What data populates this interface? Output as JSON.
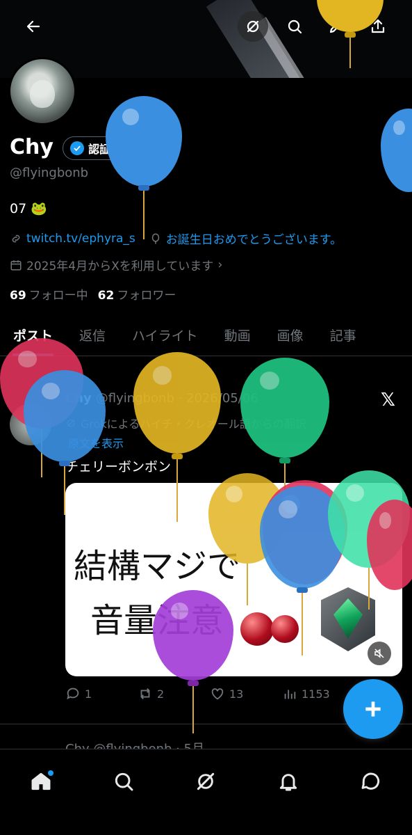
{
  "profile": {
    "name": "Chy",
    "verify_label": "認証を受ける",
    "handle": "@flyingbonb",
    "bio": "07 🐸",
    "link": "twitch.tv/ephyra_s",
    "birthday": "お誕生日おめでとうございます。",
    "joined": "2025年4月からXを利用しています",
    "following_count": "69",
    "following_label": "フォロー中",
    "followers_count": "62",
    "followers_label": "フォロワー"
  },
  "tabs": [
    "ポスト",
    "返信",
    "ハイライト",
    "動画",
    "画像",
    "記事"
  ],
  "post": {
    "name": "Chy",
    "handle_date": "@flyingbonb · 2026/05/06",
    "translation": "Grokによるハイチ・クレオール語からの翻訳",
    "show_original": "原文を表示",
    "text": "チェリーボンボン",
    "media_line1": "結構マジで",
    "media_line2": "音量注意",
    "replies": "1",
    "reposts": "2",
    "likes": "13",
    "views": "1153"
  },
  "next_post": {
    "preview": "Chy @flyingbonb · 5月"
  },
  "icons": {
    "top": [
      "back-arrow-icon",
      "grok-icon",
      "search-icon",
      "edit-icon",
      "share-icon"
    ],
    "nav": [
      "home-icon",
      "search-icon",
      "grok-icon",
      "bell-icon",
      "message-icon"
    ]
  },
  "colors": {
    "accent": "#1d9bf0",
    "balloon_blue": "#3b8fe0",
    "balloon_yellow": "#e2b523",
    "balloon_green": "#1fbf7e",
    "balloon_red": "#e0345b",
    "balloon_purple": "#a43ed8"
  }
}
